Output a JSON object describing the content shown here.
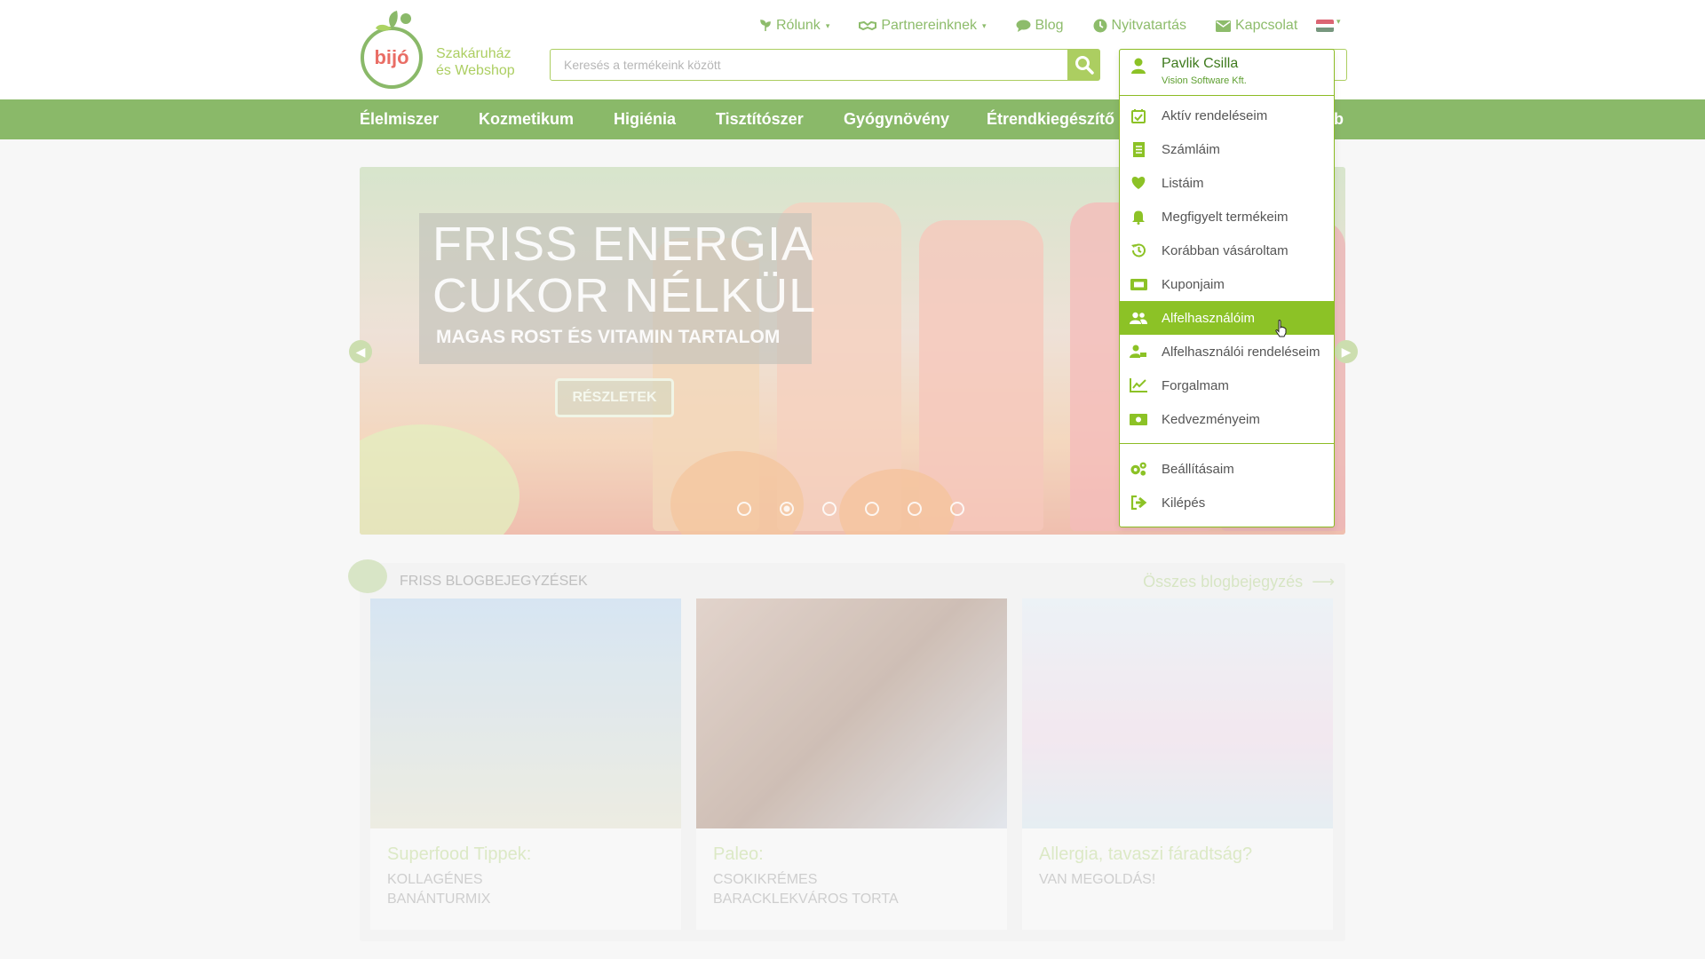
{
  "logo": {
    "text": "bijó",
    "tagline_line1": "Szakáruház",
    "tagline_line2": "és Webshop"
  },
  "topnav": [
    {
      "label": "Rólunk",
      "icon": "leaf-icon",
      "dropdown": true
    },
    {
      "label": "Partnereinknek",
      "icon": "handshake-icon",
      "dropdown": true
    },
    {
      "label": "Blog",
      "icon": "chat-icon",
      "dropdown": false
    },
    {
      "label": "Nyitvatartás",
      "icon": "clock-icon",
      "dropdown": false
    },
    {
      "label": "Kapcsolat",
      "icon": "envelope-icon",
      "dropdown": false
    }
  ],
  "language": {
    "flag": "hungary-flag-icon"
  },
  "search": {
    "placeholder": "Keresés a termékeink között"
  },
  "categories": [
    "Élelmiszer",
    "Kozmetikum",
    "Higiénia",
    "Tisztítószer",
    "Gyógynövény",
    "Étrendkiegészítő",
    "b"
  ],
  "slider": {
    "headline_line1": "FRISS ENERGIA",
    "headline_line2": "CUKOR NÉLKÜL",
    "subline": "MAGAS ROST ÉS VITAMIN TARTALOM",
    "button": "RÉSZLETEK",
    "slides_count": 6,
    "active_slide": 2
  },
  "blog": {
    "title": "FRISS BLOGBEJEGYZÉSEK",
    "all_link": "Összes blogbejegyzés",
    "posts": [
      {
        "title": "Superfood Tippek:",
        "subtitle_line1": "KOLLAGÉNES",
        "subtitle_line2": "BANÁNTURMIX"
      },
      {
        "title": "Paleo:",
        "subtitle_line1": "CSOKIKRÉMES",
        "subtitle_line2": "BARACKLEKVÁROS TORTA"
      },
      {
        "title": "Allergia, tavaszi fáradtság?",
        "subtitle_line1": "VAN MEGOLDÁS!",
        "subtitle_line2": ""
      }
    ]
  },
  "user_menu": {
    "name": "Pavlik Csilla",
    "company": "Vision Software Kft.",
    "items": [
      {
        "label": "Aktív rendeléseim",
        "icon": "calendar-check-icon"
      },
      {
        "label": "Számláim",
        "icon": "invoice-icon"
      },
      {
        "label": "Listáim",
        "icon": "heart-icon"
      },
      {
        "label": "Megfigyelt termékeim",
        "icon": "bell-icon"
      },
      {
        "label": "Korábban vásároltam",
        "icon": "history-icon"
      },
      {
        "label": "Kuponjaim",
        "icon": "ticket-icon"
      },
      {
        "label": "Alfelhasználóim",
        "icon": "users-icon",
        "active": true
      },
      {
        "label": "Alfelhasználói rendeléseim",
        "icon": "user-cart-icon"
      },
      {
        "label": "Forgalmam",
        "icon": "line-chart-icon"
      },
      {
        "label": "Kedvezményeim",
        "icon": "money-icon"
      },
      {
        "label": "Beállításaim",
        "icon": "gears-icon"
      },
      {
        "label": "Kilépés",
        "icon": "sign-out-icon"
      }
    ]
  },
  "colors": {
    "brand_green": "#5e9f30",
    "accent_green": "#8cc226",
    "text_gray": "#555555"
  }
}
